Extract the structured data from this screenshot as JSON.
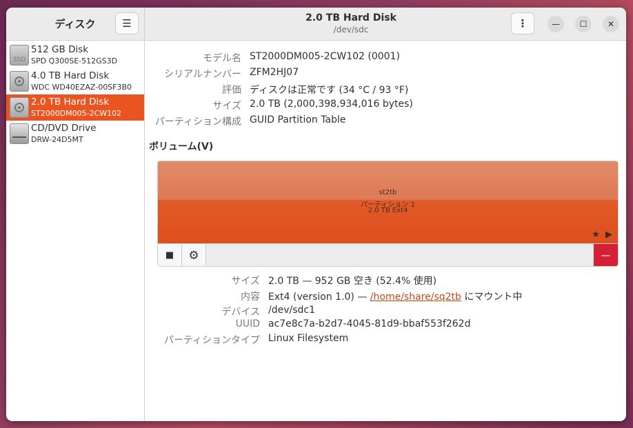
{
  "app": {
    "title": "ディスク",
    "menu_icon": "hamburger-icon"
  },
  "window": {
    "title": "2.0 TB Hard Disk",
    "subtitle": "/dev/sdc",
    "menu_label": "⋮",
    "minimize_label": "—",
    "maximize_label": "☐",
    "close_label": "✕"
  },
  "drives": [
    {
      "name": "512 GB Disk",
      "model": "SPD Q300SE-512GS3D",
      "icon": "ssd-icon",
      "icon_text": "SSD",
      "selected": false
    },
    {
      "name": "4.0 TB Hard Disk",
      "model": "WDC WD40EZAZ-00SF3B0",
      "icon": "hard-disk-icon",
      "selected": false
    },
    {
      "name": "2.0 TB Hard Disk",
      "model": "ST2000DM005-2CW102",
      "icon": "hard-disk-icon",
      "selected": true
    },
    {
      "name": "CD/DVD Drive",
      "model": "DRW-24D5MT",
      "icon": "optical-drive-icon",
      "selected": false
    }
  ],
  "disk_info": [
    {
      "label": "モデル名",
      "value": "ST2000DM005-2CW102 (0001)"
    },
    {
      "label": "シリアルナンバー",
      "value": "ZFM2HJ07"
    },
    {
      "label": "評価",
      "value": "ディスクは正常です (34 °C / 93 °F)"
    },
    {
      "label": "サイズ",
      "value": "2.0 TB (2,000,398,934,016 bytes)"
    },
    {
      "label": "パーティション構成",
      "value": "GUID Partition Table"
    }
  ],
  "volumes": {
    "heading": "ボリューム(V)",
    "partition": {
      "name": "st2tb",
      "label": "パーティション 1",
      "fs": "2.0 TB Ext4"
    },
    "partition_icons": "★ ▶",
    "toolbar": {
      "stop_label": "■",
      "gear_label": "⚙",
      "delete_label": "—"
    }
  },
  "volume_info": {
    "size_label": "サイズ",
    "size_value": "2.0 TB — 952 GB 空き (52.4% 使用)",
    "contents_label": "内容",
    "contents_prefix": "Ext4 (version 1.0) — ",
    "contents_link": "/home/share/sq2tb",
    "contents_suffix": " にマウント中",
    "device_label": "デバイス",
    "device_value": "/dev/sdc1",
    "uuid_label": "UUID",
    "uuid_value": "ac7e8c7a-b2d7-4045-81d9-bbaf553f262d",
    "ptype_label": "パーティションタイプ",
    "ptype_value": "Linux Filesystem"
  },
  "colors": {
    "accent": "#e95420",
    "delete": "#d51f34"
  }
}
